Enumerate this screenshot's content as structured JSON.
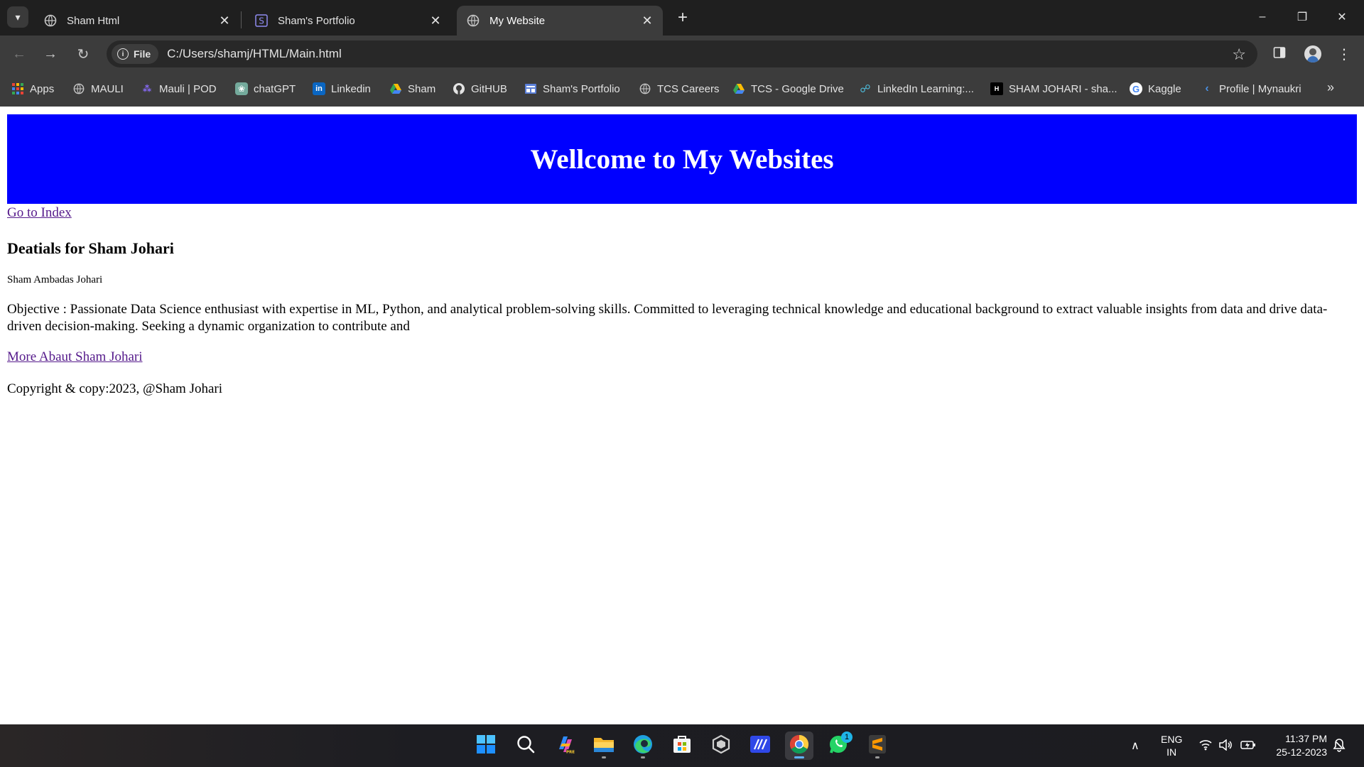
{
  "browser": {
    "tabs": [
      {
        "title": "Sham Html",
        "active": false,
        "favicon": "globe-icon"
      },
      {
        "title": "Sham's Portfolio",
        "active": false,
        "favicon": "s-box-icon"
      },
      {
        "title": "My Website",
        "active": true,
        "favicon": "globe-icon"
      }
    ],
    "omnibox": {
      "chip_label": "File",
      "url": "C:/Users/shamj/HTML/Main.html"
    },
    "bookmarks": [
      {
        "label": "Apps",
        "icon": "apps-grid-icon"
      },
      {
        "label": "MAULI",
        "icon": "globe-icon"
      },
      {
        "label": "Mauli | POD",
        "icon": "mauli-icon"
      },
      {
        "label": "chatGPT",
        "icon": "chatgpt-icon"
      },
      {
        "label": "Linkedin",
        "icon": "linkedin-icon"
      },
      {
        "label": "Sham",
        "icon": "google-drive-icon"
      },
      {
        "label": "GitHUB",
        "icon": "github-icon"
      },
      {
        "label": "Sham's Portfolio",
        "icon": "portfolio-icon"
      },
      {
        "label": "TCS Careers",
        "icon": "globe-icon"
      },
      {
        "label": "TCS - Google Drive",
        "icon": "google-drive-icon"
      },
      {
        "label": "LinkedIn Learning:...",
        "icon": "linkedin-learning-icon"
      },
      {
        "label": "SHAM JOHARI - sha...",
        "icon": "hackerrank-icon"
      },
      {
        "label": "Kaggle",
        "icon": "google-icon"
      },
      {
        "label": "Profile | Mynaukri",
        "icon": "naukri-icon"
      }
    ]
  },
  "page": {
    "banner_title": "Wellcome to My Websites",
    "index_link": "Go to Index",
    "heading": "Deatials for Sham Johari",
    "full_name": "Sham Ambadas Johari",
    "objective": "Objective : Passionate Data Science enthusiast with expertise in ML, Python, and analytical problem-solving skills. Committed to leveraging technical knowledge and educational background to extract valuable insights from data and drive data-driven decision-making. Seeking a dynamic organization to contribute and",
    "more_link": "More Abaut Sham Johari",
    "copyright": "Copyright & copy:2023, @Sham Johari",
    "colors": {
      "banner_bg": "#0000ff",
      "banner_text": "#ffffff",
      "link": "#551a8b"
    }
  },
  "taskbar": {
    "apps": [
      "start-icon",
      "search-icon",
      "copilot-icon",
      "file-explorer-icon",
      "edge-icon",
      "store-icon",
      "unity-icon",
      "vscode-like-icon",
      "chrome-icon",
      "whatsapp-icon",
      "sublime-icon"
    ],
    "whatsapp_badge": "1",
    "language_top": "ENG",
    "language_bottom": "IN",
    "time": "11:37 PM",
    "date": "25-12-2023"
  }
}
